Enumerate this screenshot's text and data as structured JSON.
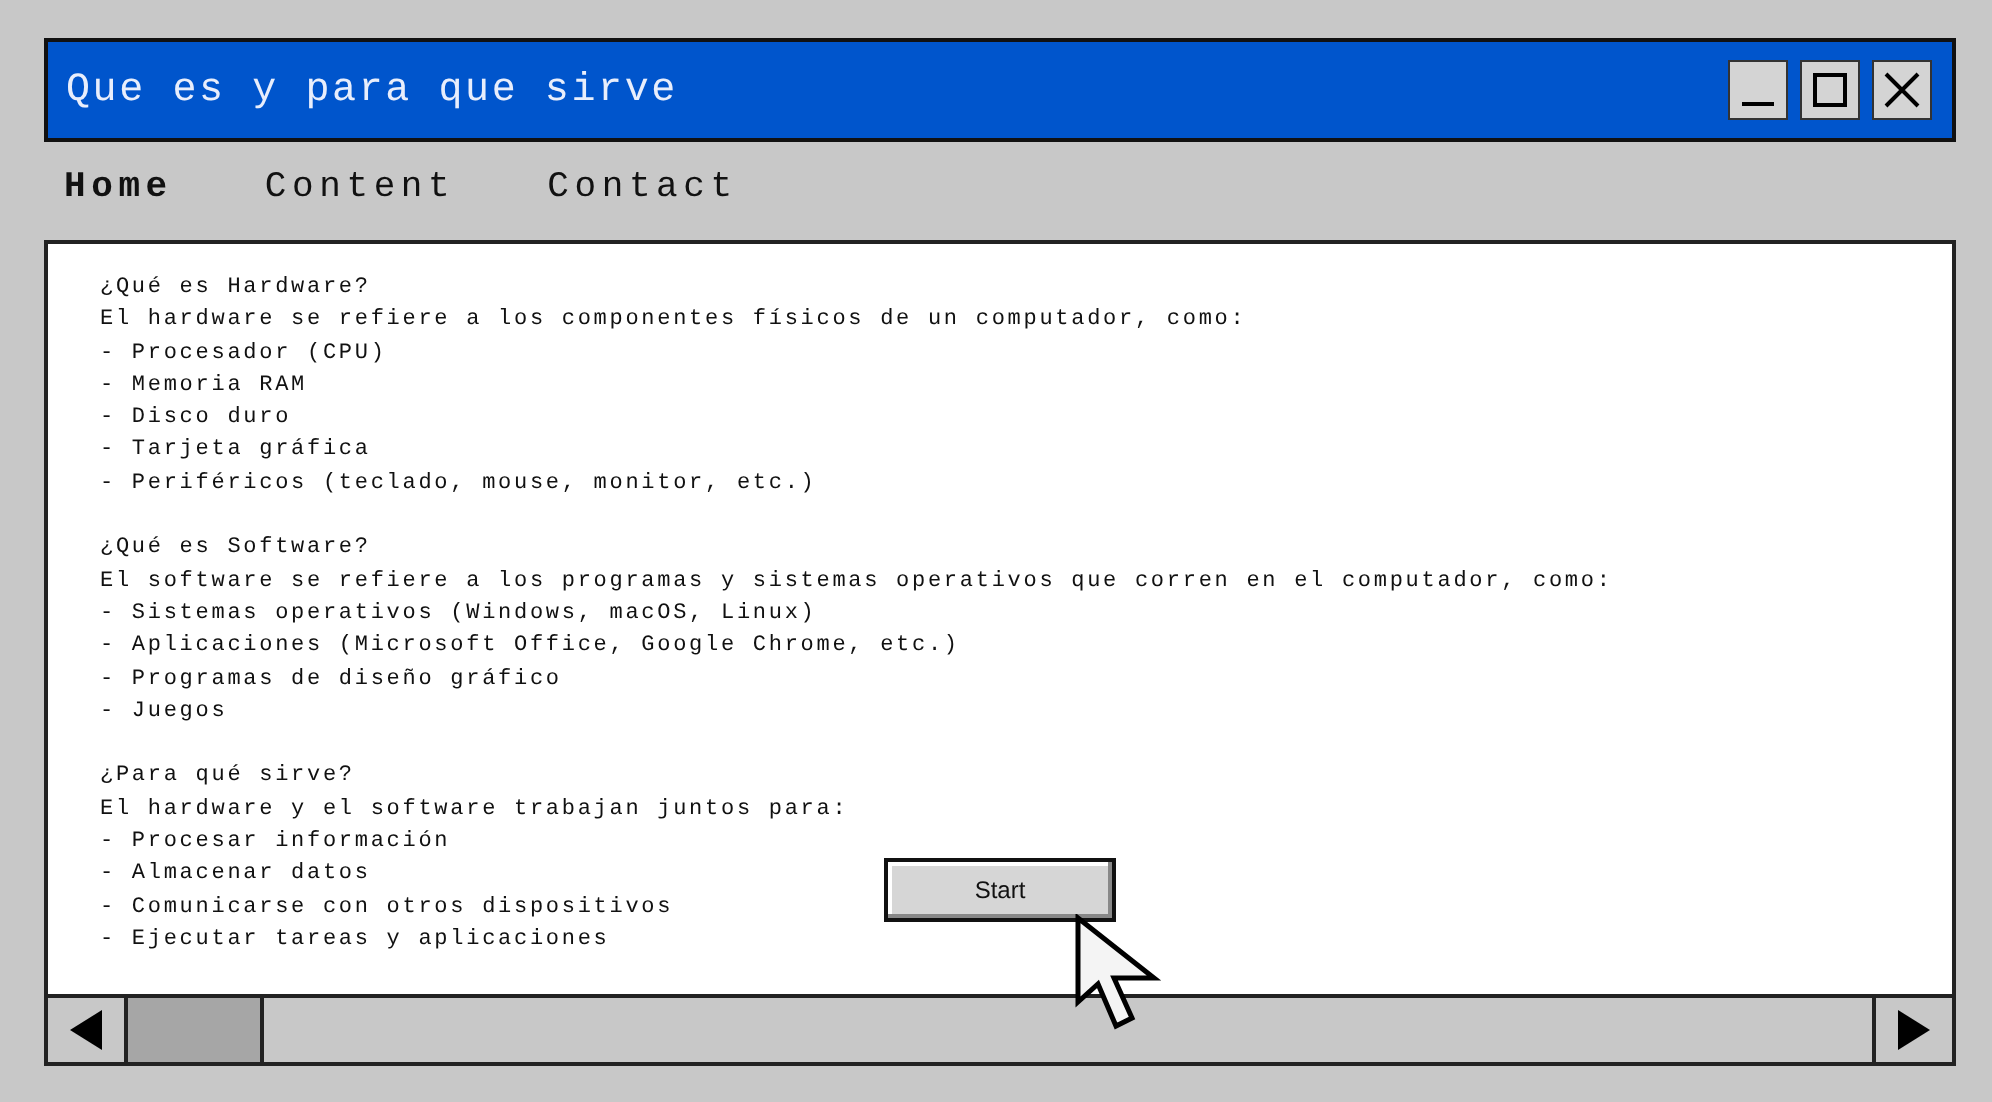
{
  "window": {
    "title": "Que es y para que sirve",
    "controls": [
      {
        "kind": "minimize"
      },
      {
        "kind": "maximize"
      },
      {
        "kind": "close"
      }
    ]
  },
  "nav": [
    {
      "label": "Home",
      "selected": true
    },
    {
      "label": "Content",
      "selected": false
    },
    {
      "label": "Contact",
      "selected": false
    }
  ],
  "sections": [
    {
      "heading": "¿Qué es Hardware?",
      "intro": "El hardware se refiere a los componentes físicos de un computador, como:",
      "items": [
        "- Procesador (CPU)",
        "- Memoria RAM",
        "- Disco duro",
        "- Tarjeta gráfica",
        "- Periféricos (teclado, mouse, monitor, etc.)"
      ]
    },
    {
      "heading": "¿Qué es Software?",
      "intro": "El software se refiere a los programas y sistemas operativos que corren en el computador, como:",
      "items": [
        "- Sistemas operativos (Windows, macOS, Linux)",
        "- Aplicaciones (Microsoft Office, Google Chrome, etc.)",
        "- Programas de diseño gráfico",
        "- Juegos"
      ]
    },
    {
      "heading": "¿Para qué sirve?",
      "intro": "El hardware y el software trabajan juntos para:",
      "items": [
        "- Procesar información",
        "- Almacenar datos",
        "- Comunicarse con otros dispositivos",
        "- Ejecutar tareas y aplicaciones"
      ]
    }
  ],
  "start_button": {
    "label": "Start"
  }
}
